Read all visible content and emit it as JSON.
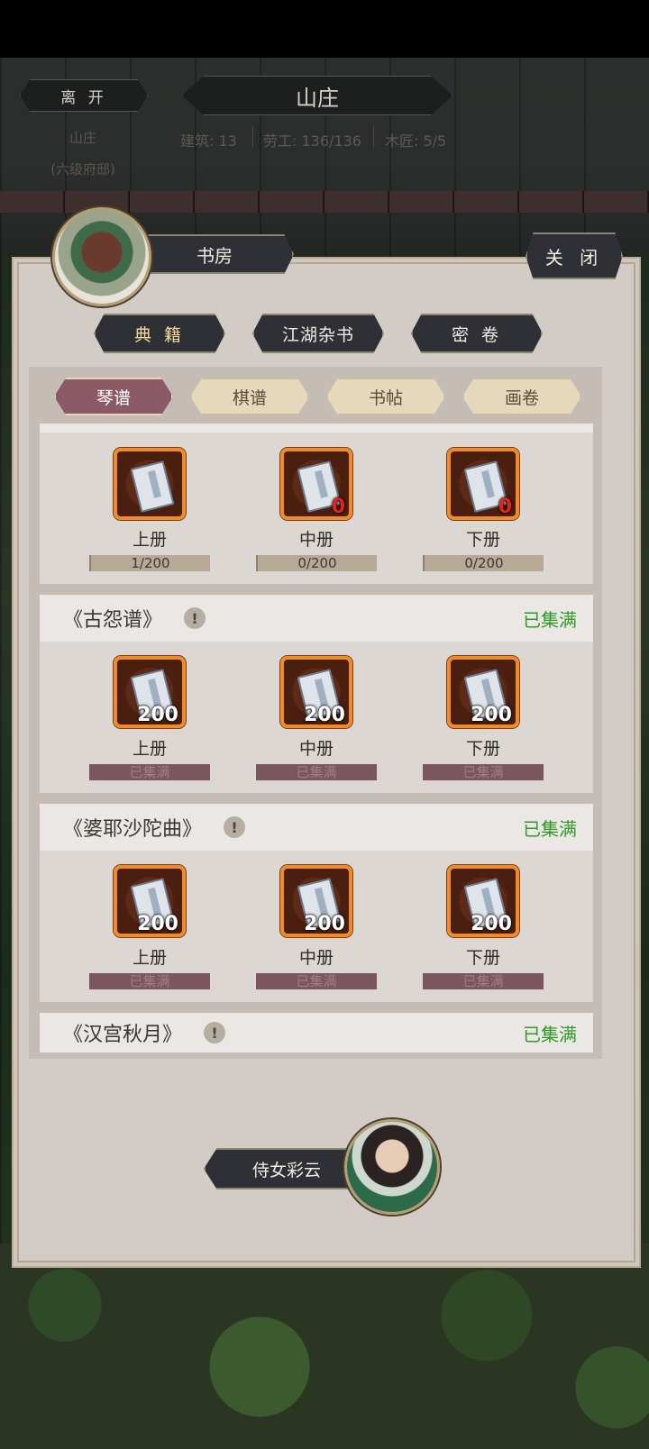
{
  "header": {
    "leave_label": "离 开",
    "title": "山庄",
    "subtitle_name": "山庄",
    "subtitle_rank": "(六级府邸)",
    "stats": [
      "建筑: 13",
      "劳工: 136/136",
      "木匠: 5/5"
    ]
  },
  "panel": {
    "title": "书房",
    "close_label": "关 闭",
    "categories": [
      {
        "label": "典 籍",
        "active": true
      },
      {
        "label": "江湖杂书",
        "active": false
      },
      {
        "label": "密 卷",
        "active": false
      }
    ],
    "tabs": [
      {
        "label": "琴谱",
        "active": true
      },
      {
        "label": "棋谱",
        "active": false
      },
      {
        "label": "书帖",
        "active": false
      },
      {
        "label": "画卷",
        "active": false
      }
    ]
  },
  "books": [
    {
      "name": "",
      "status": "",
      "volumes": [
        {
          "label": "上册",
          "count": "",
          "progress": "1/200",
          "full": false
        },
        {
          "label": "中册",
          "count": "0",
          "progress": "0/200",
          "full": false
        },
        {
          "label": "下册",
          "count": "0",
          "progress": "0/200",
          "full": false
        }
      ]
    },
    {
      "name": "《古怨谱》",
      "warn": "!",
      "status": "已集满",
      "volumes": [
        {
          "label": "上册",
          "count": "200",
          "progress": "已集满",
          "full": true
        },
        {
          "label": "中册",
          "count": "200",
          "progress": "已集满",
          "full": true
        },
        {
          "label": "下册",
          "count": "200",
          "progress": "已集满",
          "full": true
        }
      ]
    },
    {
      "name": "《婆耶沙陀曲》",
      "warn": "!",
      "status": "已集满",
      "volumes": [
        {
          "label": "上册",
          "count": "200",
          "progress": "已集满",
          "full": true
        },
        {
          "label": "中册",
          "count": "200",
          "progress": "已集满",
          "full": true
        },
        {
          "label": "下册",
          "count": "200",
          "progress": "已集满",
          "full": true
        }
      ]
    },
    {
      "name": "《汉宫秋月》",
      "warn": "!",
      "status": "已集满"
    }
  ],
  "maid": {
    "label": "侍女彩云"
  },
  "colors": {
    "complete_green": "#2f9a25",
    "zero_count_red": "#e3241c",
    "icon_border_orange": "#f08a2a",
    "active_tab": "#8a5a66"
  }
}
